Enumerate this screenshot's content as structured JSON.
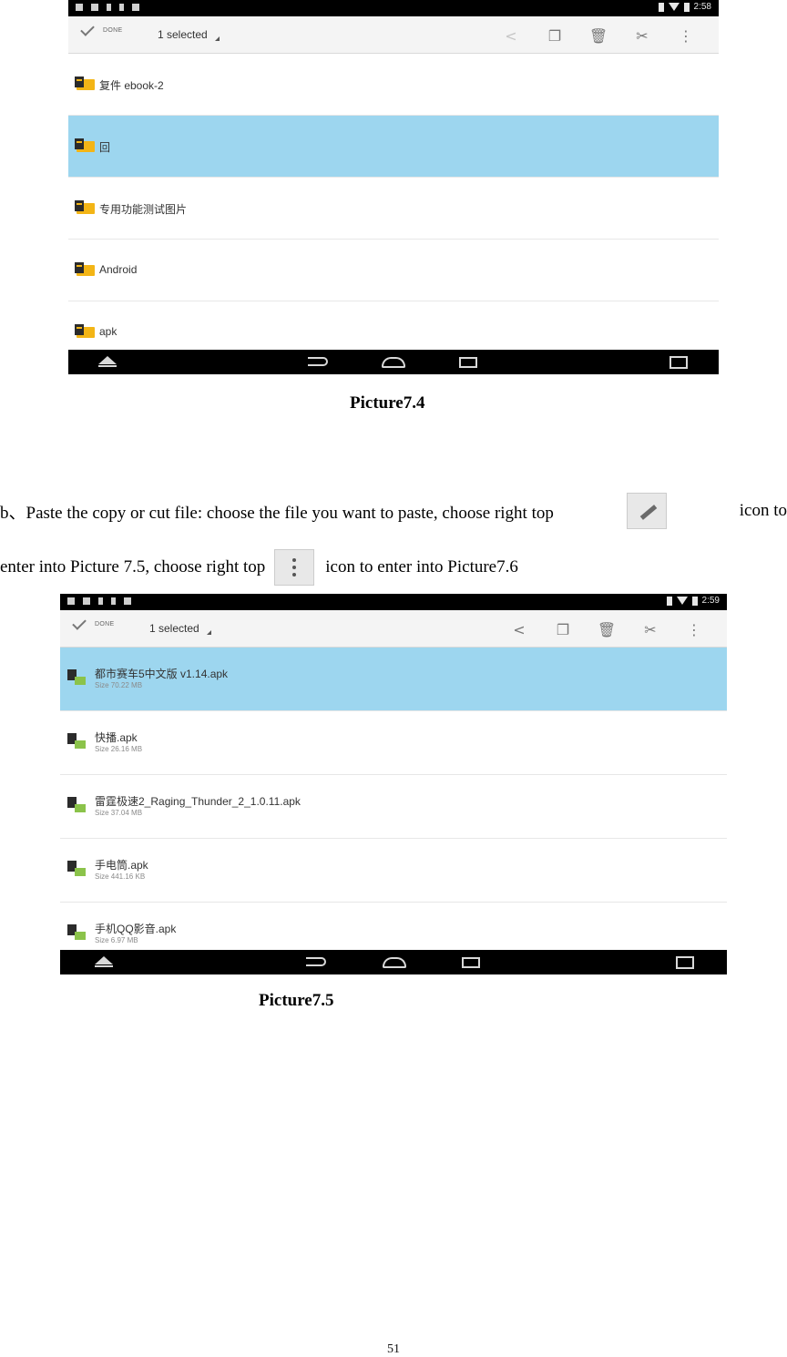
{
  "picture74": {
    "status": {
      "time": "2:58"
    },
    "actionbar": {
      "done_label": "DONE",
      "selected_label": "1 selected"
    },
    "actions": [
      "share-icon",
      "copy-icon",
      "delete-icon",
      "cut-icon",
      "overflow-icon"
    ],
    "rows": [
      {
        "name": "复件 ebook-2",
        "selected": false
      },
      {
        "name": "回",
        "selected": true
      },
      {
        "name": "专用功能测试图片",
        "selected": false
      },
      {
        "name": "Android",
        "selected": false
      },
      {
        "name": "apk",
        "selected": false
      }
    ],
    "caption": "Picture7.4"
  },
  "paragraph": {
    "line1_a": "b、Paste the copy or cut file: choose the file you want to paste, choose right top",
    "line1_b": "icon to",
    "line2_a": "enter into Picture 7.5, choose right top",
    "line2_b": "icon to enter into Picture7.6"
  },
  "picture75": {
    "status": {
      "time": "2:59"
    },
    "actionbar": {
      "done_label": "DONE",
      "selected_label": "1 selected"
    },
    "rows": [
      {
        "name": "都市赛车5中文版 v1.14.apk",
        "size": "Size 70.22 MB",
        "selected": true
      },
      {
        "name": "快播.apk",
        "size": "Size 26.16 MB",
        "selected": false
      },
      {
        "name": "雷霆极速2_Raging_Thunder_2_1.0.11.apk",
        "size": "Size 37.04 MB",
        "selected": false
      },
      {
        "name": "手电筒.apk",
        "size": "Size 441.16 KB",
        "selected": false
      },
      {
        "name": "手机QQ影音.apk",
        "size": "Size 6.97 MB",
        "selected": false
      }
    ],
    "caption": "Picture7.5"
  },
  "page_number": "51"
}
